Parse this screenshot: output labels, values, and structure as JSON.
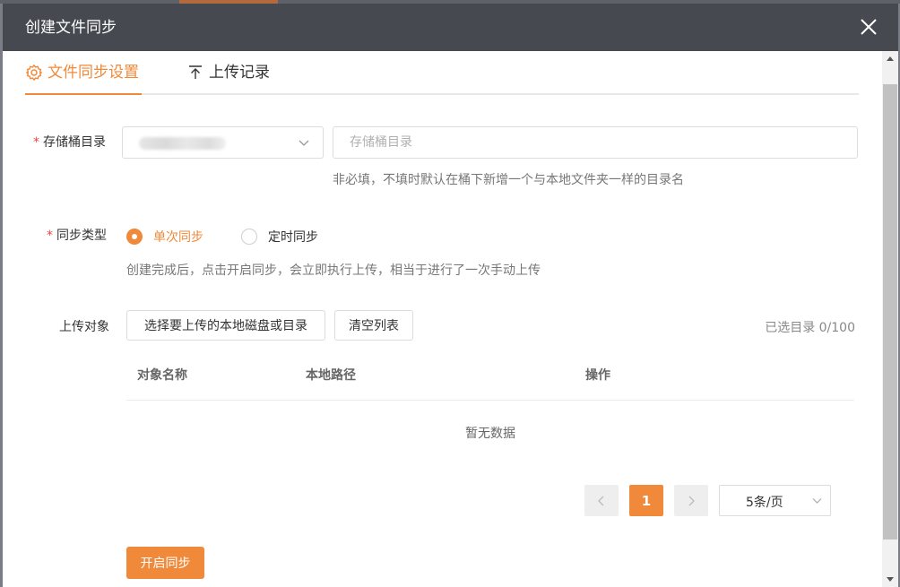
{
  "dialog": {
    "title": "创建文件同步",
    "close_icon": "close-icon"
  },
  "tabs": [
    {
      "label": "文件同步设置",
      "icon": "gear-icon",
      "active": true
    },
    {
      "label": "上传记录",
      "icon": "upload-icon",
      "active": false
    }
  ],
  "form": {
    "bucket_dir": {
      "label": "存储桶目录",
      "required_mark": "*",
      "dir_placeholder": "存储桶目录",
      "hint": "非必填，不填时默认在桶下新增一个与本地文件夹一样的目录名"
    },
    "sync_type": {
      "label": "同步类型",
      "required_mark": "*",
      "options": [
        "单次同步",
        "定时同步"
      ],
      "selected": "单次同步",
      "hint": "创建完成后，点击开启同步，会立即执行上传，相当于进行了一次手动上传"
    },
    "upload_target": {
      "label": "上传对象",
      "choose_button": "选择要上传的本地磁盘或目录",
      "clear_button": "清空列表",
      "selected_count": "已选目录 0/100"
    }
  },
  "table": {
    "columns": [
      "对象名称",
      "本地路径",
      "操作"
    ],
    "rows": [],
    "empty_text": "暂无数据"
  },
  "pagination": {
    "current_page": "1",
    "page_size": "5条/页"
  },
  "actions": {
    "start_sync": "开启同步"
  },
  "colors": {
    "accent": "#f08a3a",
    "titlebar": "#464950",
    "required": "#ee4444"
  }
}
